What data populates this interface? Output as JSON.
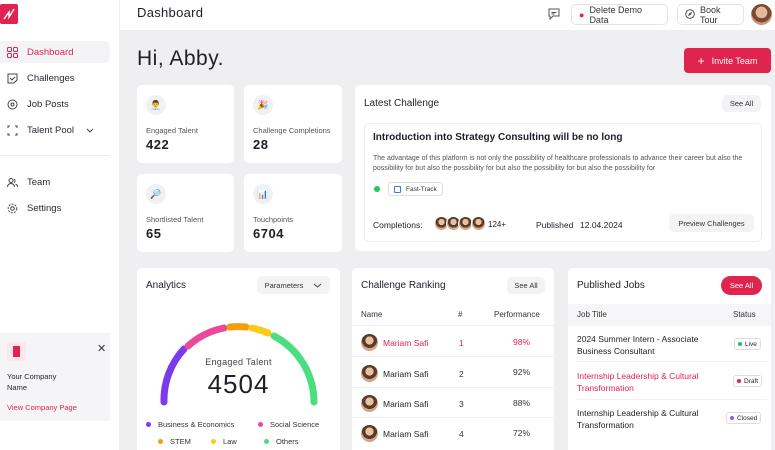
{
  "sidebar": {
    "items": [
      {
        "label": "Dashboard",
        "icon": "dashboard-icon"
      },
      {
        "label": "Challenges",
        "icon": "challenges-icon"
      },
      {
        "label": "Job Posts",
        "icon": "job-posts-icon"
      },
      {
        "label": "Talent Pool",
        "icon": "talent-pool-icon"
      },
      {
        "label": "Team",
        "icon": "team-icon"
      },
      {
        "label": "Settings",
        "icon": "settings-icon"
      }
    ],
    "company": {
      "name": "Your Company\nName",
      "link": "View Company Page"
    }
  },
  "header": {
    "title": "Dashboard",
    "delete_demo": "Delete Demo Data",
    "book_tour": "Book Tour"
  },
  "greeting": "Hi, Abby.",
  "invite_button": "Invite Team",
  "stats": [
    {
      "label": "Engaged Talent",
      "value": "422",
      "icon": "talent-icon"
    },
    {
      "label": "Challenge Completions",
      "value": "28",
      "icon": "party-icon"
    },
    {
      "label": "Shortlisted Talent",
      "value": "65",
      "icon": "search-icon"
    },
    {
      "label": "Touchpoints",
      "value": "6704",
      "icon": "bar-chart-icon"
    }
  ],
  "latest_challenge": {
    "title": "Latest Challenge",
    "see_all": "See All",
    "challenge_title": "Introduction into Strategy Consulting will be no long",
    "description": "The advantage of this platform is not only the possibility of healthcare professionals to advance their career but also the possibility for but also the possibility for but also the possibility for but also the possibility for",
    "tag": "Fast-Track",
    "completions_label": "Completions:",
    "completions_count": "124+",
    "published_label": "Published",
    "published_date": "12.04.2024",
    "preview_button": "Preview Challenges"
  },
  "analytics": {
    "title": "Analytics",
    "parameters": "Parameters",
    "gauge_label": "Engaged Talent",
    "gauge_value": "4504",
    "legend": [
      {
        "label": "Business & Economics",
        "color": "#7c3aed"
      },
      {
        "label": "Social Science",
        "color": "#ec4899"
      },
      {
        "label": "STEM",
        "color": "#f59e0b"
      },
      {
        "label": "Law",
        "color": "#facc15"
      },
      {
        "label": "Others",
        "color": "#4ade80"
      }
    ]
  },
  "ranking": {
    "title": "Challenge  Ranking",
    "see_all": "See All",
    "headers": [
      "Name",
      "#",
      "Performance"
    ],
    "rows": [
      {
        "name": "Mariam Safi",
        "rank": "1",
        "perf": "98%",
        "highlight": true
      },
      {
        "name": "Mariam Safi",
        "rank": "2",
        "perf": "92%",
        "highlight": false
      },
      {
        "name": "Mariam Safi",
        "rank": "3",
        "perf": "88%",
        "highlight": false
      },
      {
        "name": "Mariam Safi",
        "rank": "4",
        "perf": "72%",
        "highlight": false
      }
    ]
  },
  "jobs": {
    "title": "Published Jobs",
    "see_all": "See All",
    "headers": [
      "Job Title",
      "Status"
    ],
    "rows": [
      {
        "title": "2024 Summer Intern - Associate Business Consultant",
        "status": "Live",
        "status_color": "#22c55e",
        "highlight": false
      },
      {
        "title": "Internship Leadership & Cultural Transformation",
        "status": "Draft",
        "status_color": "#e0234f",
        "highlight": true
      },
      {
        "title": "Internship Leadership & Cultural Transformation",
        "status": "Closed",
        "status_color": "#8b5cf6",
        "highlight": false
      }
    ]
  },
  "colors": {
    "accent": "#e0234f"
  }
}
